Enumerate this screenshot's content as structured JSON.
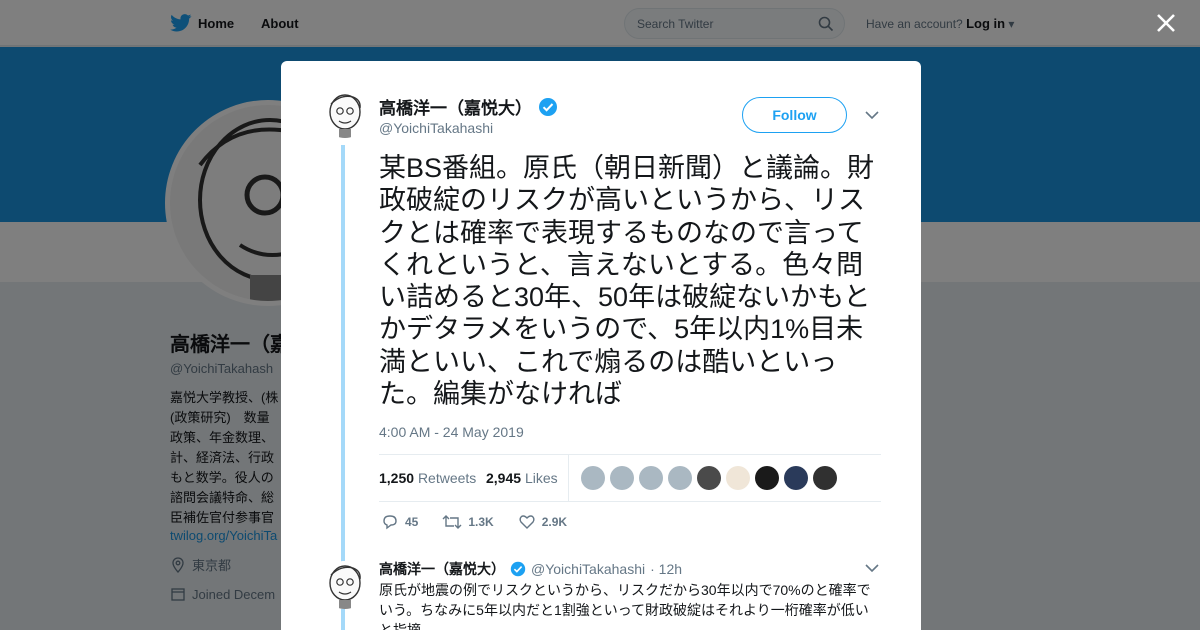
{
  "topbar": {
    "home_label": "Home",
    "about_label": "About",
    "search_placeholder": "Search Twitter",
    "account_prompt": "Have an account?",
    "login_label": "Log in"
  },
  "profile": {
    "name": "高橋洋一（嘉",
    "handle": "@YoichiTakahash",
    "bio": "嘉悦大学教授、(株\n(政策研究)　数量\n政策、年金数理、\n計、経済法、行政\nもと数学。役人の\n諮問会議特命、総\n臣補佐官付参事官",
    "link": "twilog.org/YoichiTa",
    "location": "東京都",
    "joined": "Joined Decem"
  },
  "tweet": {
    "author_name": "高橋洋一（嘉悦大）",
    "author_handle": "@YoichiTakahashi",
    "follow_label": "Follow",
    "text": "某BS番組。原氏（朝日新聞）と議論。財政破綻のリスクが高いというから、リスクとは確率で表現するものなので言ってくれというと、言えないとする。色々問い詰めると30年、50年は破綻ないかもとかデタラメをいうので、5年以内1%目未満といい、これで煽るのは酷いといった。編集がなければ",
    "timestamp": "4:00 AM - 24 May 2019",
    "retweets_count": "1,250",
    "retweets_label": "Retweets",
    "likes_count": "2,945",
    "likes_label": "Likes",
    "reply_count": "45",
    "retweet_count_short": "1.3K",
    "like_count_short": "2.9K",
    "liker_colors": [
      "#aab8c2",
      "#aab8c2",
      "#aab8c2",
      "#aab8c2",
      "#4a4a4a",
      "#f0e6d8",
      "#1a1a1a",
      "#2a3a5a",
      "#303030"
    ]
  },
  "reply": {
    "author_name": "高橋洋一（嘉悦大）",
    "author_handle": "@YoichiTakahashi",
    "age": "· 12h",
    "text": "原氏が地震の例でリスクというから、リスクだから30年以内で70%のと確率でいう。ちなみに5年以内だと1割強といって財政破綻はそれより一桁確率が低いと指摘"
  },
  "colors": {
    "accent": "#1da1f2",
    "banner": "#1b95e0",
    "verified": "#1da1f2"
  }
}
